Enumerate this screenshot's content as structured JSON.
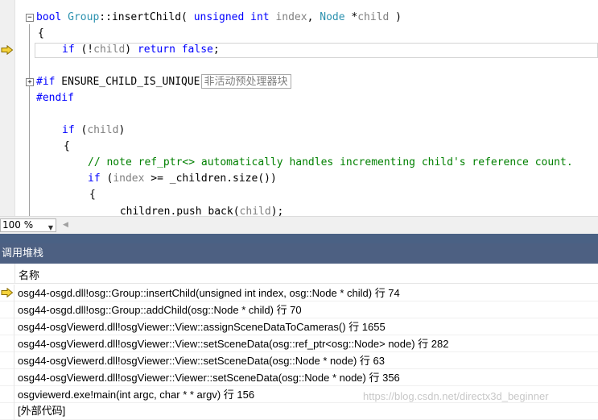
{
  "editor": {
    "lines": {
      "l1": {
        "kw_bool": "bool",
        "ty_group": "Group",
        "sep": "::",
        "func": "insertChild",
        "open": "( ",
        "kw_unsigned": "unsigned",
        "kw_int": " int",
        "prm_index": " index",
        "comma": ", ",
        "ty_node": "Node",
        "star": " *",
        "prm_child": "child",
        "close": " )"
      },
      "l2": "{",
      "l3": {
        "kw_if": "if",
        "p1": " (!",
        "prm": "child",
        "p2": ") ",
        "kw_return": "return",
        "sp": " ",
        "kw_false": "false",
        "semi": ";"
      },
      "l4": {
        "kw_if": "#if",
        "name": " ENSURE_CHILD_IS_UNIQUE",
        "inactive_label": "非活动预处理器块"
      },
      "l5": "#endif",
      "l6": {
        "kw_if": "if",
        "p1": " (",
        "prm": "child",
        "p2": ")"
      },
      "l7": "{",
      "l8": "// note ref_ptr<> automatically handles incrementing child's reference count.",
      "l9": {
        "kw_if": "if",
        "p1": " (",
        "prm": "index",
        "p2": " >= _children.size())"
      },
      "l10": "{",
      "l11": {
        "p1": "_children.push_back(",
        "prm": "child",
        "p2": ");"
      }
    }
  },
  "zoom": {
    "value": "100 %"
  },
  "call_stack": {
    "title": "调用堆栈",
    "column_name": "名称",
    "frames": [
      "osg44-osgd.dll!osg::Group::insertChild(unsigned int index, osg::Node * child) 行 74",
      "osg44-osgd.dll!osg::Group::addChild(osg::Node * child) 行 70",
      "osg44-osgViewerd.dll!osgViewer::View::assignSceneDataToCameras() 行 1655",
      "osg44-osgViewerd.dll!osgViewer::View::setSceneData(osg::ref_ptr<osg::Node> node) 行 282",
      "osg44-osgViewerd.dll!osgViewer::View::setSceneData(osg::Node * node) 行 63",
      "osg44-osgViewerd.dll!osgViewer::Viewer::setSceneData(osg::Node * node) 行 356",
      "osgviewerd.exe!main(int argc, char * * argv) 行 156",
      "[外部代码]"
    ]
  },
  "watermark": "https://blog.csdn.net/directx3d_beginner",
  "colors": {
    "keyword": "#0000ff",
    "type": "#2b91af",
    "comment": "#008000",
    "param": "#808080",
    "panel": "#4d6082",
    "arrow": "#f5d33c"
  }
}
